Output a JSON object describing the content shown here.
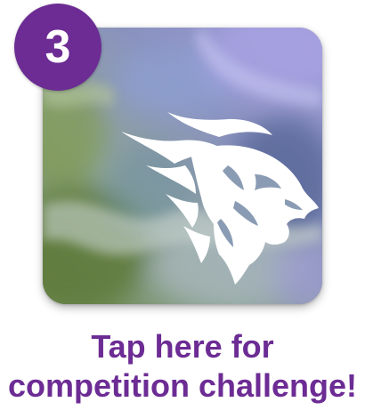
{
  "step_badge": {
    "number": "3"
  },
  "tile": {
    "icon": "lion-head-icon",
    "background": "watercolor-blue-purple-green"
  },
  "cta": {
    "line1": "Tap here for",
    "line2": "competition challenge!"
  },
  "colors": {
    "accent": "#6c2c94",
    "icon": "#ffffff"
  }
}
